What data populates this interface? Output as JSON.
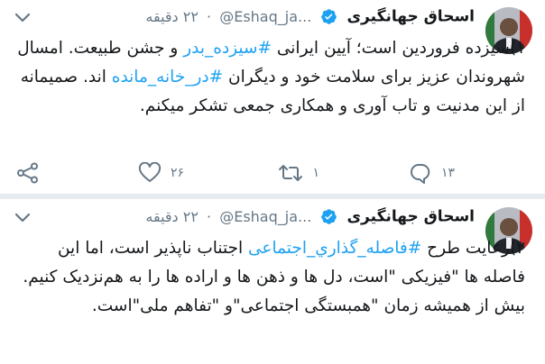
{
  "tweets": [
    {
      "author_name": "اسحاق جهانگیری",
      "handle": "@Eshaq_ja...",
      "time": "۲۲ دقیقه",
      "body_parts": [
        {
          "text": "۱)سیزده فروردین است؛ آیین ایرانی ",
          "hashtag": false
        },
        {
          "text": "#سیزده_بدر",
          "hashtag": true
        },
        {
          "text": " و جشن طبیعت. امسال شهروندان عزیز برای سلامت خود و دیگران ",
          "hashtag": false
        },
        {
          "text": "#در_خانه_مانده",
          "hashtag": true
        },
        {
          "text": " اند. صمیمانه از این مدنیت و تاب آوری و همکاری جمعی تشکر میکنم.",
          "hashtag": false
        }
      ],
      "reply_count": "۱۳",
      "retweet_count": "۱",
      "like_count": "۲۶"
    },
    {
      "author_name": "اسحاق جهانگیری",
      "handle": "@Eshaq_ja...",
      "time": "۲۲ دقیقه",
      "body_parts": [
        {
          "text": "۲)رعایت طرح ",
          "hashtag": false
        },
        {
          "text": "#فاصله_گذاري_اجتماعی",
          "hashtag": true
        },
        {
          "text": " اجتناب ناپذیر است، اما این فاصله ها \"فیزیکی \"است، دل ها و ذهن ها و اراده ها را به هم‌نزدیک کنیم. بیش از همیشه زمان \"همبستگی اجتماعی\"و \"تفاهم ملی\"است.",
          "hashtag": false
        }
      ]
    }
  ],
  "icons": {
    "verified": "verified-badge-icon",
    "caret": "chevron-down-icon",
    "reply": "reply-icon",
    "retweet": "retweet-icon",
    "like": "heart-icon",
    "share": "share-icon"
  },
  "colors": {
    "accent": "#1da1f2",
    "secondary_text": "#657786",
    "primary_text": "#14171a",
    "separator": "#e6ecf0"
  }
}
